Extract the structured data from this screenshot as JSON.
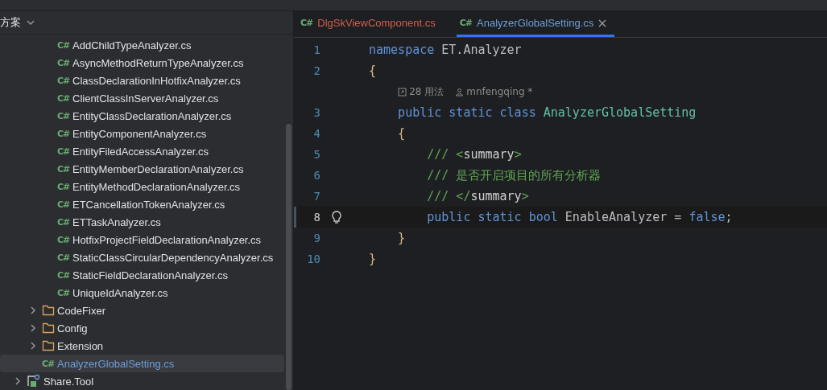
{
  "sidebar": {
    "header": "方案",
    "tree": [
      {
        "children": [
          {
            "children": [
              {
                "label": "AddChildTypeAnalyzer.cs",
                "kind": "file",
                "icon_text": "C#",
                "selected": false
              },
              {
                "label": "AsyncMethodReturnTypeAnalyzer.cs",
                "kind": "file",
                "icon_text": "C#",
                "selected": false
              },
              {
                "label": "ClassDeclarationInHotfixAnalyzer.cs",
                "kind": "file",
                "icon_text": "C#",
                "selected": false
              },
              {
                "label": "ClientClassInServerAnalyzer.cs",
                "kind": "file",
                "icon_text": "C#",
                "selected": false
              },
              {
                "label": "EntityClassDeclarationAnalyzer.cs",
                "kind": "file",
                "icon_text": "C#",
                "selected": false
              },
              {
                "label": "EntityComponentAnalyzer.cs",
                "kind": "file",
                "icon_text": "C#",
                "selected": false
              },
              {
                "label": "EntityFiledAccessAnalyzer.cs",
                "kind": "file",
                "icon_text": "C#",
                "selected": false
              },
              {
                "label": "EntityMemberDeclarationAnalyzer.cs",
                "kind": "file",
                "icon_text": "C#",
                "selected": false
              },
              {
                "label": "EntityMethodDeclarationAnalyzer.cs",
                "kind": "file",
                "icon_text": "C#",
                "selected": false
              },
              {
                "label": "ETCancellationTokenAnalyzer.cs",
                "kind": "file",
                "icon_text": "C#",
                "selected": false
              },
              {
                "label": "ETTaskAnalyzer.cs",
                "kind": "file",
                "icon_text": "C#",
                "selected": false
              },
              {
                "label": "HotfixProjectFieldDeclarationAnalyzer.cs",
                "kind": "file",
                "icon_text": "C#",
                "selected": false
              },
              {
                "label": "StaticClassCircularDependencyAnalyzer.cs",
                "kind": "file",
                "icon_text": "C#",
                "selected": false
              },
              {
                "label": "StaticFieldDeclarationAnalyzer.cs",
                "kind": "file",
                "icon_text": "C#",
                "selected": false
              },
              {
                "label": "UniqueIdAnalyzer.cs",
                "kind": "file",
                "icon_text": "C#",
                "selected": false
              }
            ]
          },
          {
            "label": "CodeFixer",
            "kind": "folder",
            "expanded": false,
            "selected": false
          },
          {
            "label": "Config",
            "kind": "folder",
            "expanded": false,
            "selected": false
          },
          {
            "label": "Extension",
            "kind": "folder",
            "expanded": false,
            "selected": false
          },
          {
            "label": "AnalyzerGlobalSetting.cs",
            "kind": "file",
            "icon_text": "C#",
            "selected": true
          }
        ]
      },
      {
        "label": "Share.Tool",
        "kind": "project",
        "expanded": false,
        "selected": false
      }
    ]
  },
  "tabs": [
    {
      "label": "DlgSkViewComponent.cs",
      "icon_text": "C#",
      "selected": false,
      "error": true,
      "closable": false
    },
    {
      "label": "AnalyzerGlobalSetting.cs",
      "icon_text": "C#",
      "selected": true,
      "error": false,
      "closable": true
    }
  ],
  "code": [
    {
      "kind": "line",
      "number": "1",
      "current": false,
      "tokens": [
        {
          "kind": "keyword",
          "text": "namespace"
        },
        {
          "kind": "plain",
          "text": " ET.Analyzer"
        }
      ]
    },
    {
      "kind": "line",
      "number": "2",
      "current": false,
      "tokens": [
        {
          "kind": "punct",
          "text": "{"
        }
      ]
    },
    {
      "kind": "hint",
      "usages": "28 用法",
      "author": "mnfengqing *"
    },
    {
      "kind": "line",
      "number": "3",
      "current": false,
      "tokens": [
        {
          "kind": "keyword",
          "text": "    public static class"
        },
        {
          "kind": "class",
          "text": " AnalyzerGlobalSetting"
        }
      ]
    },
    {
      "kind": "line",
      "number": "4",
      "current": false,
      "tokens": [
        {
          "kind": "punct",
          "text": "    {"
        }
      ]
    },
    {
      "kind": "line",
      "number": "5",
      "current": false,
      "tokens": [
        {
          "kind": "comment",
          "text": "        /// <"
        },
        {
          "kind": "doc",
          "text": "summary"
        },
        {
          "kind": "comment",
          "text": ">"
        }
      ]
    },
    {
      "kind": "line",
      "number": "6",
      "current": false,
      "tokens": [
        {
          "kind": "comment",
          "text": "        /// 是否开启项目的所有分析器"
        }
      ]
    },
    {
      "kind": "line",
      "number": "7",
      "current": false,
      "tokens": [
        {
          "kind": "comment",
          "text": "        /// </"
        },
        {
          "kind": "doc",
          "text": "summary"
        },
        {
          "kind": "comment",
          "text": ">"
        }
      ]
    },
    {
      "kind": "line",
      "number": "8",
      "current": true,
      "tokens": [
        {
          "kind": "keyword",
          "text": "        public static bool"
        },
        {
          "kind": "plain",
          "text": " EnableAnalyzer = "
        },
        {
          "kind": "keyword",
          "text": "false"
        },
        {
          "kind": "plain",
          "text": ";"
        }
      ]
    },
    {
      "kind": "line",
      "number": "9",
      "current": false,
      "tokens": [
        {
          "kind": "punct",
          "text": "    }"
        }
      ]
    },
    {
      "kind": "line",
      "number": "10",
      "current": false,
      "tokens": [
        {
          "kind": "punct",
          "text": "}"
        }
      ]
    }
  ]
}
